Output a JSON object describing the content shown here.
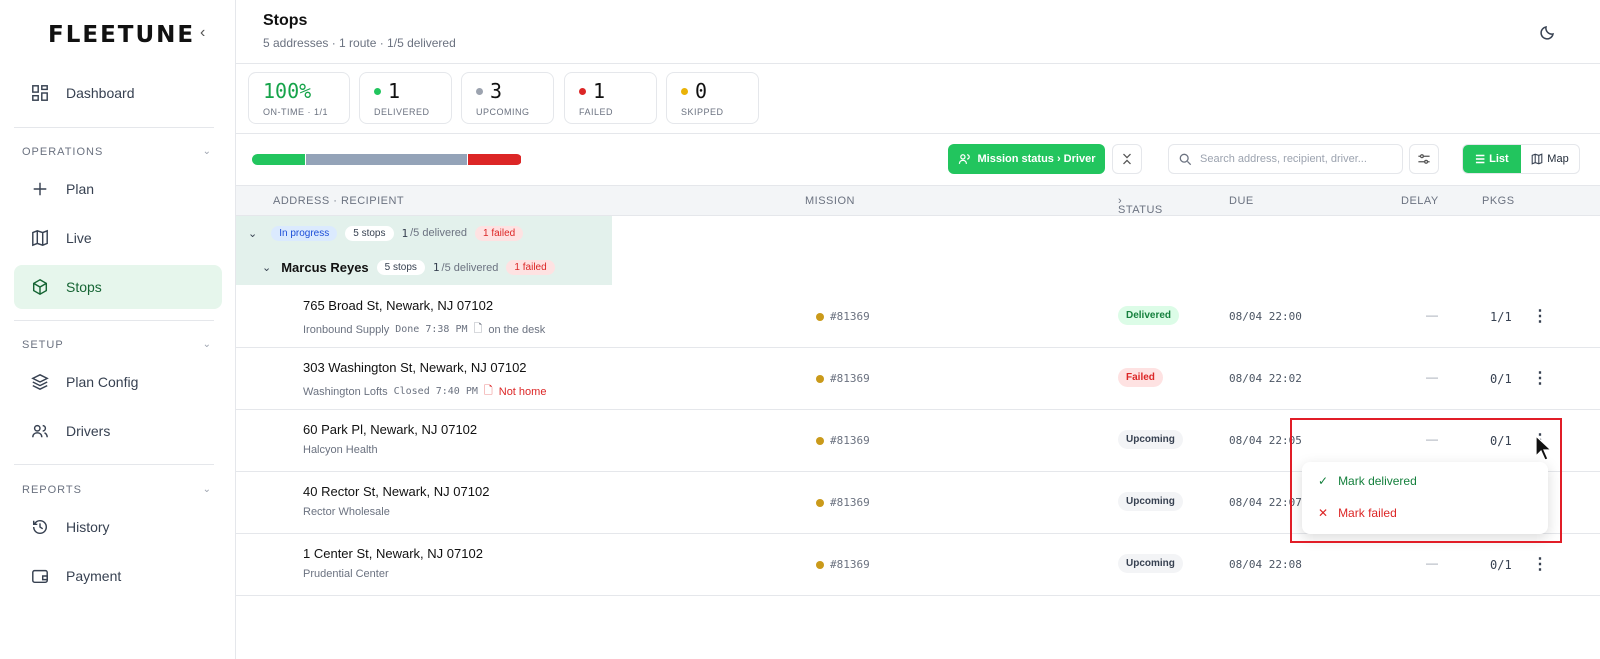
{
  "brand": {
    "logo": "FLEETUNE",
    "collapse": "‹"
  },
  "sidebar": {
    "dashboard": "Dashboard",
    "sections": [
      {
        "label": "OPERATIONS",
        "items": [
          "Plan",
          "Live",
          "Stops"
        ]
      },
      {
        "label": "SETUP",
        "items": [
          "Plan Config",
          "Drivers"
        ]
      },
      {
        "label": "REPORTS",
        "items": [
          "History",
          "Payment"
        ]
      }
    ],
    "active": "Stops"
  },
  "header": {
    "title": "Stops",
    "subtitle": "5 addresses · 1 route · 1/5 delivered"
  },
  "kpis": [
    {
      "value": "100%",
      "label": "ON-TIME · 1/1",
      "color": "#16a34a"
    },
    {
      "value": "1",
      "label": "DELIVERED",
      "color": "#22c55e"
    },
    {
      "value": "3",
      "label": "UPCOMING",
      "color": "#9ca3af"
    },
    {
      "value": "1",
      "label": "FAILED",
      "color": "#dc2626"
    },
    {
      "value": "0",
      "label": "SKIPPED",
      "color": "#eab308"
    }
  ],
  "progress": {
    "delivered": 1,
    "upcoming": 3,
    "failed": 1,
    "total": 5
  },
  "toolbar": {
    "mission_button": "Mission status › Driver",
    "search_placeholder": "Search address, recipient, driver...",
    "view_list": "List",
    "view_map": "Map"
  },
  "table": {
    "columns": {
      "address": "ADDRESS · RECIPIENT",
      "mission": "MISSION",
      "status": "STATUS",
      "due": "DUE",
      "delay": "DELAY",
      "pkgs": "PKGS"
    },
    "group": {
      "status": "In progress",
      "stops": "5 stops",
      "delivered_count": "1",
      "delivered_text": "/5 delivered",
      "failed": "1 failed"
    },
    "subgroup": {
      "driver": "Marcus Reyes",
      "stops": "5 stops",
      "delivered_count": "1",
      "delivered_text": "/5 delivered",
      "failed": "1 failed"
    },
    "rows": [
      {
        "address": "765 Broad St, Newark, NJ 07102",
        "recipient": "Ironbound Supply",
        "event": "Done 7:38 PM",
        "note": "on the desk",
        "mission": "#81369",
        "status": "Delivered",
        "due": "08/04 22:00",
        "delay": "—",
        "pkgs": "1/1"
      },
      {
        "address": "303 Washington St, Newark, NJ 07102",
        "recipient": "Washington Lofts",
        "event": "Closed 7:40 PM",
        "note": "Not home",
        "mission": "#81369",
        "status": "Failed",
        "due": "08/04 22:02",
        "delay": "—",
        "pkgs": "0/1"
      },
      {
        "address": "60 Park Pl, Newark, NJ 07102",
        "recipient": "Halcyon Health",
        "event": "",
        "note": "",
        "mission": "#81369",
        "status": "Upcoming",
        "due": "08/04 22:05",
        "delay": "—",
        "pkgs": "0/1"
      },
      {
        "address": "40 Rector St, Newark, NJ 07102",
        "recipient": "Rector Wholesale",
        "event": "",
        "note": "",
        "mission": "#81369",
        "status": "Upcoming",
        "due": "08/04 22:07",
        "delay": "",
        "pkgs": ""
      },
      {
        "address": "1 Center St, Newark, NJ 07102",
        "recipient": "Prudential Center",
        "event": "",
        "note": "",
        "mission": "#81369",
        "status": "Upcoming",
        "due": "08/04 22:08",
        "delay": "—",
        "pkgs": "0/1"
      }
    ]
  },
  "context_menu": {
    "mark_delivered": "Mark delivered",
    "mark_failed": "Mark failed"
  },
  "colors": {
    "accent": "#22c55e",
    "active_bg": "#e6f6ec",
    "failed": "#dc2626",
    "upcoming": "#94a3b8",
    "mission_dot": "#ca9a1a"
  }
}
